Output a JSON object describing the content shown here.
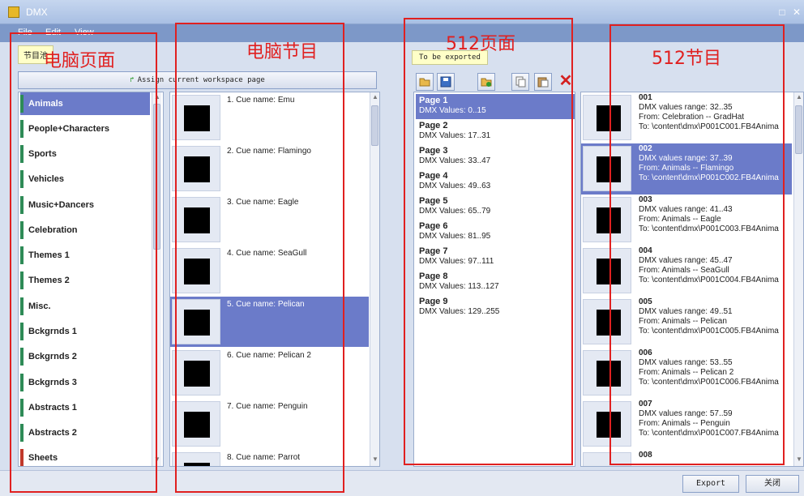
{
  "window": {
    "title": "DMX"
  },
  "menu": [
    "File",
    "Edit",
    "View"
  ],
  "left_tab": "节目池",
  "export_tab": "To be exported",
  "assign_button": "Assign current workspace page",
  "toolbar_icons": [
    "open-folder-icon",
    "save-icon",
    "add-folder-icon",
    "copy-icon",
    "paste-icon",
    "delete-icon"
  ],
  "categories": [
    {
      "label": "Animals",
      "selected": true
    },
    {
      "label": "People+Characters"
    },
    {
      "label": "Sports"
    },
    {
      "label": "Vehicles"
    },
    {
      "label": "Music+Dancers"
    },
    {
      "label": "Celebration"
    },
    {
      "label": "Themes 1"
    },
    {
      "label": "Themes 2"
    },
    {
      "label": "Misc."
    },
    {
      "label": "Bckgrnds 1"
    },
    {
      "label": "Bckgrnds 2"
    },
    {
      "label": "Bckgrnds 3"
    },
    {
      "label": "Abstracts 1"
    },
    {
      "label": "Abstracts 2"
    },
    {
      "label": "Sheets"
    }
  ],
  "cues": [
    {
      "label": "1. Cue name: Emu"
    },
    {
      "label": "2. Cue name: Flamingo"
    },
    {
      "label": "3. Cue name: Eagle"
    },
    {
      "label": "4. Cue name: SeaGull"
    },
    {
      "label": "5. Cue name: Pelican",
      "selected": true
    },
    {
      "label": "6. Cue name: Pelican 2"
    },
    {
      "label": "7. Cue name: Penguin"
    },
    {
      "label": "8. Cue name: Parrot"
    }
  ],
  "pages": [
    {
      "name": "Page 1",
      "values": "DMX Values: 0..15",
      "selected": true
    },
    {
      "name": "Page 2",
      "values": "DMX Values: 17..31"
    },
    {
      "name": "Page 3",
      "values": "DMX Values: 33..47"
    },
    {
      "name": "Page 4",
      "values": "DMX Values: 49..63"
    },
    {
      "name": "Page 5",
      "values": "DMX Values: 65..79"
    },
    {
      "name": "Page 6",
      "values": "DMX Values: 81..95"
    },
    {
      "name": "Page 7",
      "values": "DMX Values: 97..111"
    },
    {
      "name": "Page 8",
      "values": "DMX Values: 113..127"
    },
    {
      "name": "Page 9",
      "values": "DMX Values: 129..255"
    }
  ],
  "exports": [
    {
      "num": "001",
      "range": "DMX values range: 32..35",
      "from": "From: Celebration -- GradHat",
      "to": "To: \\content\\dmx\\P001C001.FB4Anima"
    },
    {
      "num": "002",
      "range": "DMX values range: 37..39",
      "from": "From: Animals -- Flamingo",
      "to": "To: \\content\\dmx\\P001C002.FB4Anima",
      "selected": true
    },
    {
      "num": "003",
      "range": "DMX values range: 41..43",
      "from": "From: Animals -- Eagle",
      "to": "To: \\content\\dmx\\P001C003.FB4Anima"
    },
    {
      "num": "004",
      "range": "DMX values range: 45..47",
      "from": "From: Animals -- SeaGull",
      "to": "To: \\content\\dmx\\P001C004.FB4Anima"
    },
    {
      "num": "005",
      "range": "DMX values range: 49..51",
      "from": "From: Animals -- Pelican",
      "to": "To: \\content\\dmx\\P001C005.FB4Anima"
    },
    {
      "num": "006",
      "range": "DMX values range: 53..55",
      "from": "From: Animals -- Pelican 2",
      "to": "To: \\content\\dmx\\P001C006.FB4Anima"
    },
    {
      "num": "007",
      "range": "DMX values range: 57..59",
      "from": "From: Animals -- Penguin",
      "to": "To: \\content\\dmx\\P001C007.FB4Anima"
    },
    {
      "num": "008",
      "range": "",
      "from": "",
      "to": ""
    }
  ],
  "footer": {
    "export": "Export",
    "close": "关闭"
  },
  "annotations": {
    "pc_page": "电脑页面",
    "pc_program": "电脑节目",
    "page_512": "512页面",
    "program_512": "512节目"
  },
  "colors": {
    "selection": "#6b7bc9",
    "annotation": "#e02020",
    "category_mark": "#2e8b57",
    "sheets_mark": "#c0392b"
  }
}
